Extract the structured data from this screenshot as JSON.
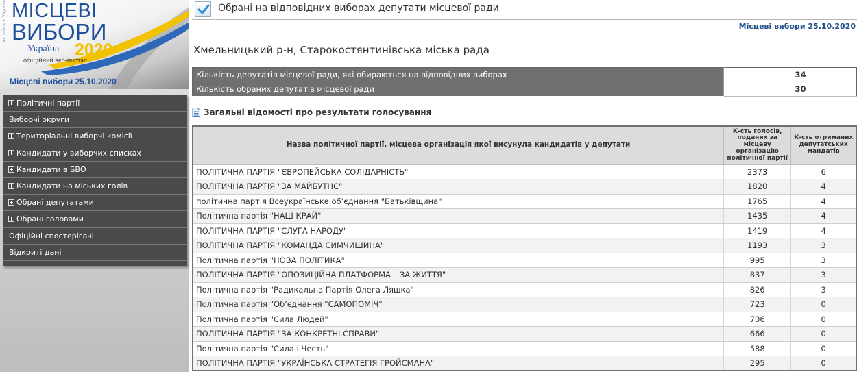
{
  "banner": {
    "title_line1": "МІСЦЕВІ",
    "title_line2": "ВИБОРИ",
    "country": "Україна",
    "year": "2020",
    "portal": "офіційний веб-портал",
    "vertical": "Україна • Україна • Україна",
    "date": "Місцеві вибори 25.10.2020",
    "colors": {
      "brand_blue": "#1d4f9c",
      "brand_yellow": "#f2c200"
    }
  },
  "menu": {
    "items": [
      {
        "label": "Політичні партії",
        "expandable": true
      },
      {
        "label": "Виборчі округи",
        "expandable": false
      },
      {
        "label": "Територіальні виборчі комісії",
        "expandable": true
      },
      {
        "label": "Кандидати у виборчих списках",
        "expandable": true
      },
      {
        "label": "Кандидати в БВО",
        "expandable": true
      },
      {
        "label": "Кандидати на міських голів",
        "expandable": true
      },
      {
        "label": "Обрані депутатами",
        "expandable": true
      },
      {
        "label": "Обрані головами",
        "expandable": true
      },
      {
        "label": "Офіційні спостерігачі",
        "expandable": false
      },
      {
        "label": "Відкриті дані",
        "expandable": false
      }
    ]
  },
  "header": {
    "heading": "Обрані на відповідних виборах депутати місцевої ради",
    "election_date": "Місцеві вибори 25.10.2020",
    "region": "Хмельницький р-н, Старокостянтинівська міська рада"
  },
  "summary": {
    "rows": [
      {
        "label": "Кількість депутатів місцевої ради, які обираються на відповідних виборах",
        "value": "34"
      },
      {
        "label": "Кількість обраних депутатів місцевої ради",
        "value": "30"
      }
    ]
  },
  "section": {
    "title": "Загальні відомості про результати голосування"
  },
  "results": {
    "headers": {
      "party": "Назва політичної партії, місцева організація якої висунула кандидатів у депутати",
      "votes": "К-сть голосів, поданих за місцеву організацію політичної партії",
      "seats": "К-сть отриманих депутатських мандатів"
    },
    "rows": [
      {
        "party": "ПОЛІТИЧНА ПАРТІЯ \"ЄВРОПЕЙСЬКА СОЛІДАРНІСТЬ\"",
        "votes": "2373",
        "seats": "6"
      },
      {
        "party": "ПОЛІТИЧНА ПАРТІЯ \"ЗА МАЙБУТНЄ\"",
        "votes": "1820",
        "seats": "4"
      },
      {
        "party": "політична партія Всеукраїнське об’єднання \"Батьківщина\"",
        "votes": "1765",
        "seats": "4"
      },
      {
        "party": "Політична партія \"НАШ КРАЙ\"",
        "votes": "1435",
        "seats": "4"
      },
      {
        "party": "ПОЛІТИЧНА ПАРТІЯ \"СЛУГА НАРОДУ\"",
        "votes": "1419",
        "seats": "4"
      },
      {
        "party": "ПОЛІТИЧНА ПАРТІЯ \"КОМАНДА СИМЧИШИНА\"",
        "votes": "1193",
        "seats": "3"
      },
      {
        "party": "Політична партія \"НОВА ПОЛІТИКА\"",
        "votes": "995",
        "seats": "3"
      },
      {
        "party": "ПОЛІТИЧНА ПАРТІЯ \"ОПОЗИЦІЙНА ПЛАТФОРМА – ЗА ЖИТТЯ\"",
        "votes": "837",
        "seats": "3"
      },
      {
        "party": "Політична партія \"Радикальна Партія Олега Ляшка\"",
        "votes": "826",
        "seats": "3"
      },
      {
        "party": "Політична партія \"Об’єднання \"САМОПОМІЧ\"",
        "votes": "723",
        "seats": "0"
      },
      {
        "party": "Політична партія \"Сила Людей\"",
        "votes": "706",
        "seats": "0"
      },
      {
        "party": "ПОЛІТИЧНА ПАРТІЯ \"ЗА КОНКРЕТНІ СПРАВИ\"",
        "votes": "666",
        "seats": "0"
      },
      {
        "party": "Політична партія \"Сила і Честь\"",
        "votes": "588",
        "seats": "0"
      },
      {
        "party": "ПОЛІТИЧНА ПАРТІЯ \"УКРАЇНСЬКА СТРАТЕГІЯ ГРОЙСМАНА\"",
        "votes": "295",
        "seats": "0"
      }
    ]
  }
}
